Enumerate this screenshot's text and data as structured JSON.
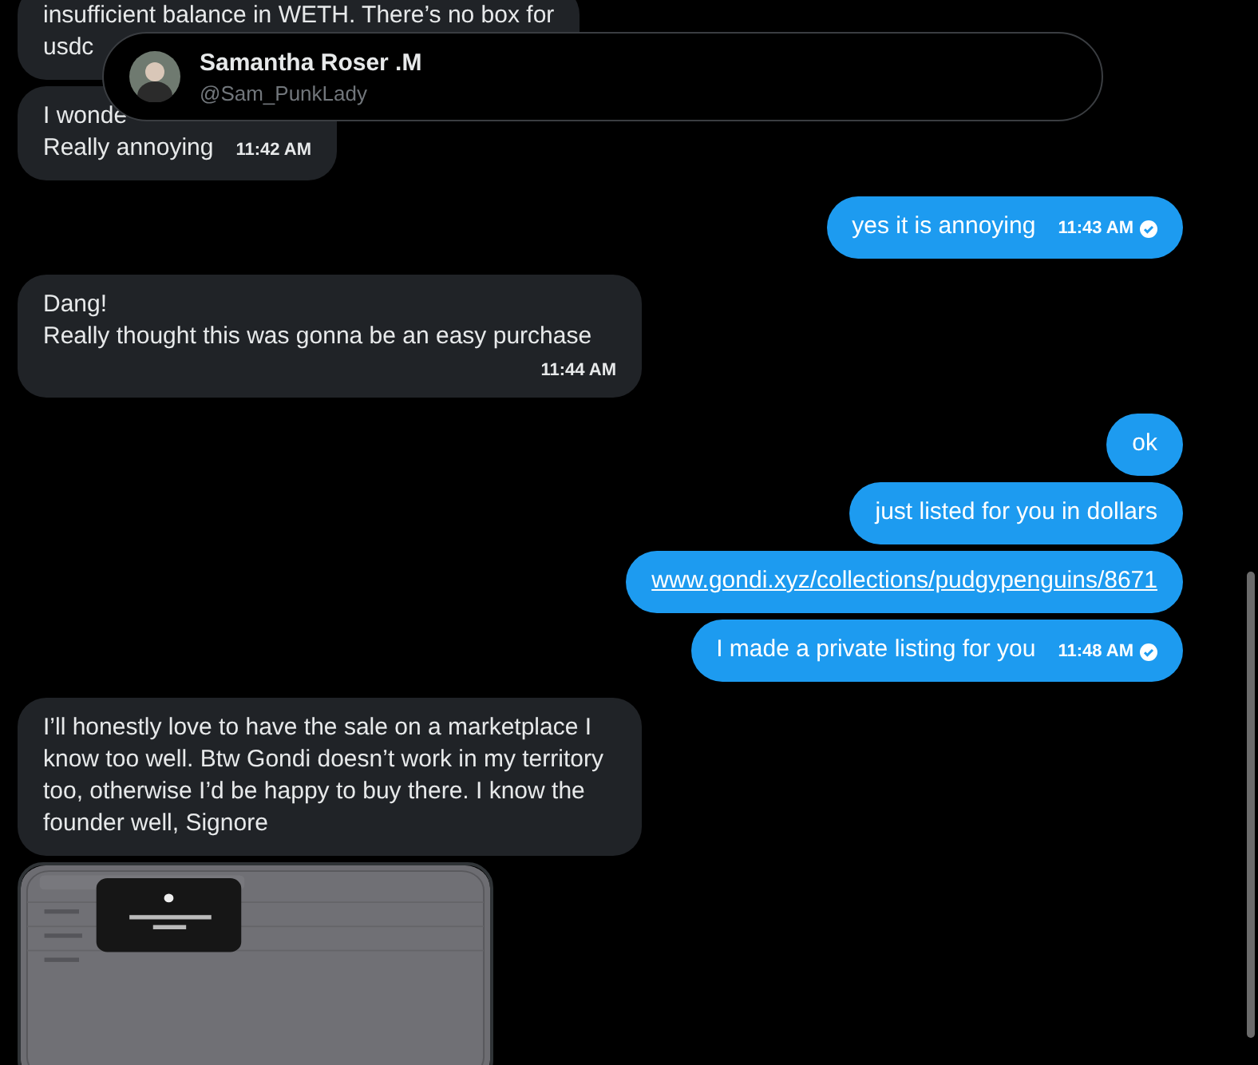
{
  "header": {
    "name": "Samantha Roser .M",
    "handle": "@Sam_PunkLady"
  },
  "messages": [
    {
      "sent": false,
      "kind": "text",
      "text": "insufficient balance in WETH. There’s no box for\nusdc"
    },
    {
      "sent": false,
      "kind": "text",
      "text": "I wonde\nReally annoying",
      "time": "11:42 AM"
    },
    {
      "sent": true,
      "kind": "text",
      "text": "yes it is annoying",
      "time": "11:43 AM",
      "read": true
    },
    {
      "sent": false,
      "kind": "text",
      "text": "Dang!\nReally thought this was gonna be an easy purchase",
      "time": "11:44 AM"
    },
    {
      "sent": true,
      "kind": "text",
      "text": "ok"
    },
    {
      "sent": true,
      "kind": "text",
      "text": "just listed for you in dollars"
    },
    {
      "sent": true,
      "kind": "link",
      "text": "www.gondi.xyz/collections/pudgypenguins/8671"
    },
    {
      "sent": true,
      "kind": "text",
      "text": "I made a private listing for you",
      "time": "11:48 AM",
      "read": true
    },
    {
      "sent": false,
      "kind": "text",
      "text": "I’ll honestly love to have the sale on a marketplace I know too well. Btw Gondi doesn’t work in my territory too, otherwise I’d be happy to buy there. I know the founder well, Signore"
    },
    {
      "sent": false,
      "kind": "picture"
    }
  ]
}
